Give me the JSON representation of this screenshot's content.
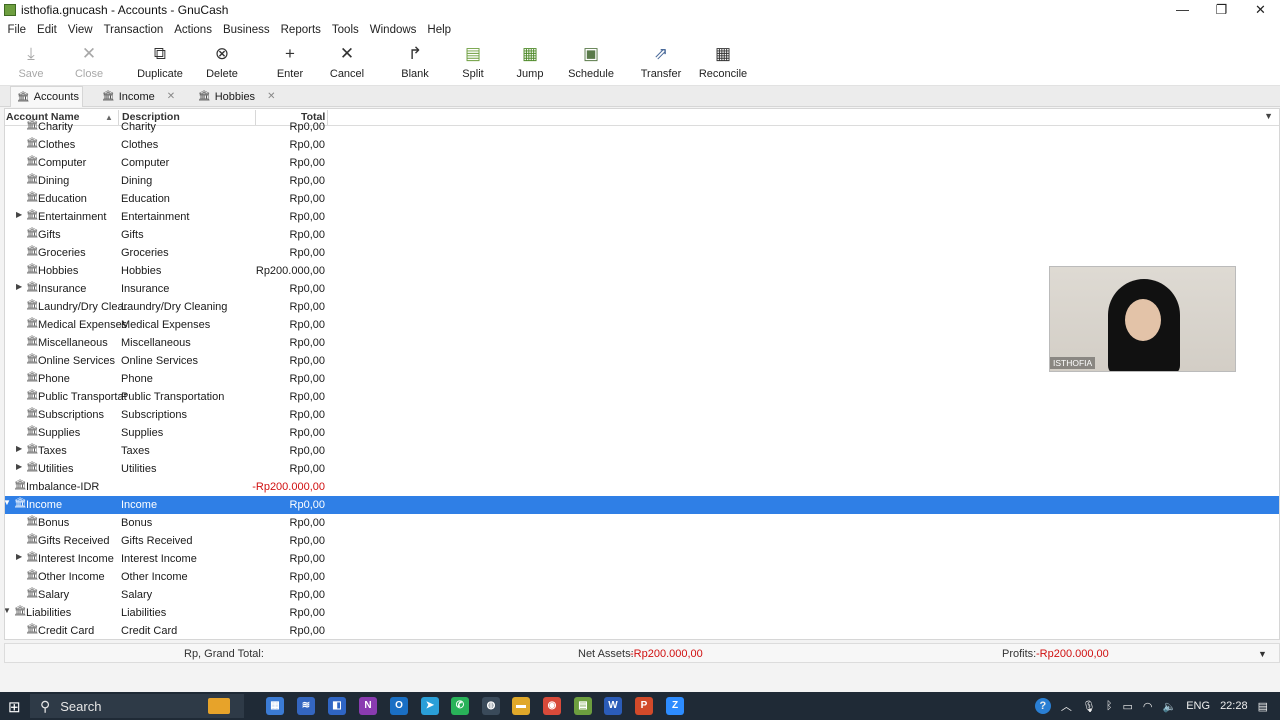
{
  "window": {
    "title": "isthofia.gnucash - Accounts - GnuCash",
    "controls": [
      "—",
      "❐",
      "✕"
    ]
  },
  "menu": [
    "File",
    "Edit",
    "View",
    "Transaction",
    "Actions",
    "Business",
    "Reports",
    "Tools",
    "Windows",
    "Help"
  ],
  "toolbar": [
    {
      "label": "Save",
      "icon": "⤓",
      "enabled": false
    },
    {
      "label": "Close",
      "icon": "✕",
      "enabled": false
    },
    {
      "label": "Duplicate",
      "icon": "⧉",
      "enabled": true
    },
    {
      "label": "Delete",
      "icon": "⊗",
      "enabled": true
    },
    {
      "label": "Enter",
      "icon": "+",
      "enabled": true
    },
    {
      "label": "Cancel",
      "icon": "✕",
      "enabled": true
    },
    {
      "label": "Blank",
      "icon": "↱",
      "enabled": true
    },
    {
      "label": "Split",
      "icon": "▤",
      "enabled": true
    },
    {
      "label": "Jump",
      "icon": "▦",
      "enabled": true
    },
    {
      "label": "Schedule",
      "icon": "▣",
      "enabled": true
    },
    {
      "label": "Transfer",
      "icon": "⇗",
      "enabled": true
    },
    {
      "label": "Reconcile",
      "icon": "▦",
      "enabled": true
    }
  ],
  "tabs": [
    {
      "label": "Accounts",
      "active": true
    },
    {
      "label": "Income",
      "active": false
    },
    {
      "label": "Hobbies",
      "active": false
    }
  ],
  "columns": {
    "name": "Account Name",
    "description": "Description",
    "total": "Total"
  },
  "rows": [
    {
      "name": "Charity",
      "desc": "Charity",
      "total": "Rp0,00",
      "level": 2,
      "expander": "none"
    },
    {
      "name": "Clothes",
      "desc": "Clothes",
      "total": "Rp0,00",
      "level": 2,
      "expander": "none"
    },
    {
      "name": "Computer",
      "desc": "Computer",
      "total": "Rp0,00",
      "level": 2,
      "expander": "none"
    },
    {
      "name": "Dining",
      "desc": "Dining",
      "total": "Rp0,00",
      "level": 2,
      "expander": "none"
    },
    {
      "name": "Education",
      "desc": "Education",
      "total": "Rp0,00",
      "level": 2,
      "expander": "none"
    },
    {
      "name": "Entertainment",
      "desc": "Entertainment",
      "total": "Rp0,00",
      "level": 2,
      "expander": "collapsed"
    },
    {
      "name": "Gifts",
      "desc": "Gifts",
      "total": "Rp0,00",
      "level": 2,
      "expander": "none"
    },
    {
      "name": "Groceries",
      "desc": "Groceries",
      "total": "Rp0,00",
      "level": 2,
      "expander": "none"
    },
    {
      "name": "Hobbies",
      "desc": "Hobbies",
      "total": "Rp200.000,00",
      "level": 2,
      "expander": "none"
    },
    {
      "name": "Insurance",
      "desc": "Insurance",
      "total": "Rp0,00",
      "level": 2,
      "expander": "collapsed"
    },
    {
      "name": "Laundry/Dry Clear",
      "desc": "Laundry/Dry Cleaning",
      "total": "Rp0,00",
      "level": 2,
      "expander": "none"
    },
    {
      "name": "Medical Expenses",
      "desc": "Medical Expenses",
      "total": "Rp0,00",
      "level": 2,
      "expander": "none"
    },
    {
      "name": "Miscellaneous",
      "desc": "Miscellaneous",
      "total": "Rp0,00",
      "level": 2,
      "expander": "none"
    },
    {
      "name": "Online Services",
      "desc": "Online Services",
      "total": "Rp0,00",
      "level": 2,
      "expander": "none"
    },
    {
      "name": "Phone",
      "desc": "Phone",
      "total": "Rp0,00",
      "level": 2,
      "expander": "none"
    },
    {
      "name": "Public Transportat",
      "desc": "Public Transportation",
      "total": "Rp0,00",
      "level": 2,
      "expander": "none"
    },
    {
      "name": "Subscriptions",
      "desc": "Subscriptions",
      "total": "Rp0,00",
      "level": 2,
      "expander": "none"
    },
    {
      "name": "Supplies",
      "desc": "Supplies",
      "total": "Rp0,00",
      "level": 2,
      "expander": "none"
    },
    {
      "name": "Taxes",
      "desc": "Taxes",
      "total": "Rp0,00",
      "level": 2,
      "expander": "collapsed"
    },
    {
      "name": "Utilities",
      "desc": "Utilities",
      "total": "Rp0,00",
      "level": 2,
      "expander": "collapsed"
    },
    {
      "name": "Imbalance-IDR",
      "desc": "",
      "total": "-Rp200.000,00",
      "level": 1,
      "expander": "none",
      "negative": true
    },
    {
      "name": "Income",
      "desc": "Income",
      "total": "Rp0,00",
      "level": 1,
      "expander": "expanded",
      "selected": true
    },
    {
      "name": "Bonus",
      "desc": "Bonus",
      "total": "Rp0,00",
      "level": 2,
      "expander": "none"
    },
    {
      "name": "Gifts Received",
      "desc": "Gifts Received",
      "total": "Rp0,00",
      "level": 2,
      "expander": "none"
    },
    {
      "name": "Interest Income",
      "desc": "Interest Income",
      "total": "Rp0,00",
      "level": 2,
      "expander": "collapsed"
    },
    {
      "name": "Other Income",
      "desc": "Other Income",
      "total": "Rp0,00",
      "level": 2,
      "expander": "none"
    },
    {
      "name": "Salary",
      "desc": "Salary",
      "total": "Rp0,00",
      "level": 2,
      "expander": "none"
    },
    {
      "name": "Liabilities",
      "desc": "Liabilities",
      "total": "Rp0,00",
      "level": 1,
      "expander": "expanded"
    },
    {
      "name": "Credit Card",
      "desc": "Credit Card",
      "total": "Rp0,00",
      "level": 2,
      "expander": "none"
    }
  ],
  "summary": {
    "grand_total_label": "Rp, Grand Total:",
    "net_assets_label": "Net Assets:",
    "net_assets_value": "-Rp200.000,00",
    "profits_label": "Profits:",
    "profits_value": "-Rp200.000,00"
  },
  "webcam": {
    "name": "ISTHOFIA"
  },
  "taskbar": {
    "search_label": "Search",
    "apps": [
      {
        "name": "file-manager",
        "color": "#3b7bd4",
        "glyph": "▦"
      },
      {
        "name": "code",
        "color": "#3466c0",
        "glyph": "≋"
      },
      {
        "name": "app-blue",
        "color": "#2f65c4",
        "glyph": "◧"
      },
      {
        "name": "onenote",
        "color": "#8a3bb0",
        "glyph": "N"
      },
      {
        "name": "outlook",
        "color": "#1a6fc4",
        "glyph": "O"
      },
      {
        "name": "telegram",
        "color": "#2a9fd8",
        "glyph": "➤"
      },
      {
        "name": "whatsapp",
        "color": "#29b259",
        "glyph": "✆"
      },
      {
        "name": "app-dark",
        "color": "#3a4a5a",
        "glyph": "◍"
      },
      {
        "name": "explorer",
        "color": "#e0a82a",
        "glyph": "▬"
      },
      {
        "name": "chrome",
        "color": "#d84a3a",
        "glyph": "◉"
      },
      {
        "name": "gnucash",
        "color": "#6d9e3f",
        "glyph": "▤"
      },
      {
        "name": "word",
        "color": "#2b5cb8",
        "glyph": "W"
      },
      {
        "name": "powerpoint",
        "color": "#d24a2a",
        "glyph": "P"
      },
      {
        "name": "zoom",
        "color": "#2d8cff",
        "glyph": "Z"
      }
    ],
    "tray": {
      "lang": "ENG",
      "time": "22:28"
    }
  }
}
